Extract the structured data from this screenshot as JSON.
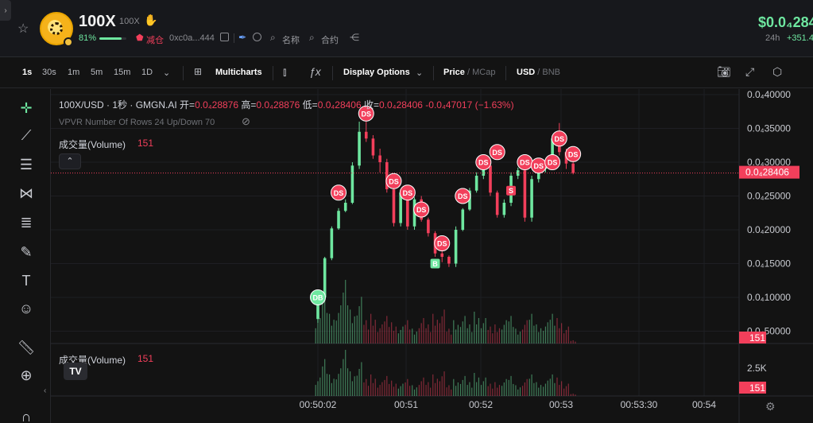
{
  "header": {
    "token_name": "100X",
    "token_symbol": "100X",
    "holder_pct": "81%",
    "holder_pct_value": 0.81,
    "reduce_label": "减仓",
    "address": "0xc0a...444",
    "search_name_label": "名称",
    "search_contract_label": "合约",
    "price": "$0.0₄284",
    "change_period": "24h",
    "change_value": "+351.4"
  },
  "toolbar": {
    "intervals": [
      "1s",
      "30s",
      "1m",
      "5m",
      "15m",
      "1D"
    ],
    "active_interval": "1s",
    "multicharts": "Multicharts",
    "display_options": "Display Options",
    "price_label": "Price",
    "mcap_label": "MCap",
    "usd_label": "USD",
    "bnb_label": "BNB"
  },
  "legend": {
    "pair": "100X/USD · 1秒 · GMGN.AI",
    "open_label": "开=",
    "open": "0.0₄28876",
    "high_label": "高=",
    "high": "0.0₄28876",
    "low_label": "低=",
    "low": "0.0₄28406",
    "close_label": "收=",
    "close": "0.0₄28406",
    "change": "-0.0₄47017 (−1.63%)",
    "vpvr": "VPVR Number Of Rows 24 Up/Down 70",
    "volume_label": "成交量(Volume)",
    "volume_value": "151"
  },
  "colors": {
    "up": "#6ee7a0",
    "down": "#f23f5b",
    "bg": "#131313"
  },
  "chart_data": {
    "type": "candlestick",
    "y_axis_ticks": [
      "0.0₄40000",
      "0.0₄35000",
      "0.0₄30000",
      "0.0₄25000",
      "0.0₄20000",
      "0.0₄15000",
      "0.0₄10000",
      "0.0₄50000"
    ],
    "y_range": [
      5e-06,
      4e-05
    ],
    "current_price_label": "0.0₄28406",
    "current_price": 2.84e-05,
    "x_axis_ticks": [
      "00:50:02",
      "00:51",
      "00:52",
      "00:53",
      "00:53:30",
      "00:54"
    ],
    "volume_axis_ticks": [
      "2.5K"
    ],
    "volume_badge": "151",
    "candles": [
      {
        "t": 0,
        "o": 6.8e-06,
        "h": 1.02e-05,
        "l": 6.2e-06,
        "c": 1e-05
      },
      {
        "t": 1,
        "o": 1e-05,
        "h": 1.6e-05,
        "l": 9.8e-06,
        "c": 1.58e-05
      },
      {
        "t": 2,
        "o": 1.58e-05,
        "h": 2.05e-05,
        "l": 1.55e-05,
        "c": 2.02e-05
      },
      {
        "t": 3,
        "o": 2.02e-05,
        "h": 2.32e-05,
        "l": 2e-05,
        "c": 2.28e-05
      },
      {
        "t": 4,
        "o": 2.28e-05,
        "h": 2.45e-05,
        "l": 2.26e-05,
        "c": 2.4e-05
      },
      {
        "t": 5,
        "o": 2.4e-05,
        "h": 3e-05,
        "l": 2.38e-05,
        "c": 2.95e-05
      },
      {
        "t": 6,
        "o": 2.95e-05,
        "h": 3.6e-05,
        "l": 2.9e-05,
        "c": 3.45e-05
      },
      {
        "t": 7,
        "o": 3.45e-05,
        "h": 3.7e-05,
        "l": 3.3e-05,
        "c": 3.35e-05
      },
      {
        "t": 8,
        "o": 3.35e-05,
        "h": 3.4e-05,
        "l": 3.05e-05,
        "c": 3.1e-05
      },
      {
        "t": 9,
        "o": 3.1e-05,
        "h": 3.2e-05,
        "l": 2.85e-05,
        "c": 3e-05
      },
      {
        "t": 10,
        "o": 3e-05,
        "h": 3.05e-05,
        "l": 2.55e-05,
        "c": 2.6e-05
      },
      {
        "t": 11,
        "o": 2.6e-05,
        "h": 2.62e-05,
        "l": 2.05e-05,
        "c": 2.1e-05
      },
      {
        "t": 12,
        "o": 2.1e-05,
        "h": 2.6e-05,
        "l": 2.05e-05,
        "c": 2.55e-05
      },
      {
        "t": 13,
        "o": 2.55e-05,
        "h": 2.65e-05,
        "l": 2e-05,
        "c": 2.05e-05
      },
      {
        "t": 14,
        "o": 2.05e-05,
        "h": 2.48e-05,
        "l": 2e-05,
        "c": 2.45e-05
      },
      {
        "t": 15,
        "o": 2.45e-05,
        "h": 2.5e-05,
        "l": 2.12e-05,
        "c": 2.15e-05
      },
      {
        "t": 16,
        "o": 2.15e-05,
        "h": 2.18e-05,
        "l": 1.9e-05,
        "c": 1.95e-05
      },
      {
        "t": 17,
        "o": 1.95e-05,
        "h": 1.98e-05,
        "l": 1.6e-05,
        "c": 1.65e-05
      },
      {
        "t": 18,
        "o": 1.65e-05,
        "h": 1.7e-05,
        "l": 1.52e-05,
        "c": 1.6e-05
      },
      {
        "t": 19,
        "o": 1.6e-05,
        "h": 1.62e-05,
        "l": 1.45e-05,
        "c": 1.5e-05
      },
      {
        "t": 20,
        "o": 1.5e-05,
        "h": 2.05e-05,
        "l": 1.45e-05,
        "c": 2e-05
      },
      {
        "t": 21,
        "o": 2e-05,
        "h": 2.32e-05,
        "l": 1.98e-05,
        "c": 2.3e-05
      },
      {
        "t": 22,
        "o": 2.3e-05,
        "h": 2.62e-05,
        "l": 2.28e-05,
        "c": 2.58e-05
      },
      {
        "t": 23,
        "o": 2.58e-05,
        "h": 2.85e-05,
        "l": 2.55e-05,
        "c": 2.8e-05
      },
      {
        "t": 24,
        "o": 2.8e-05,
        "h": 3e-05,
        "l": 2.75e-05,
        "c": 2.95e-05
      },
      {
        "t": 25,
        "o": 2.95e-05,
        "h": 2.98e-05,
        "l": 2.5e-05,
        "c": 2.55e-05
      },
      {
        "t": 26,
        "o": 2.55e-05,
        "h": 2.58e-05,
        "l": 2.18e-05,
        "c": 2.22e-05
      },
      {
        "t": 27,
        "o": 2.22e-05,
        "h": 2.45e-05,
        "l": 2.18e-05,
        "c": 2.4e-05
      },
      {
        "t": 28,
        "o": 2.4e-05,
        "h": 2.85e-05,
        "l": 2.35e-05,
        "c": 2.8e-05
      },
      {
        "t": 29,
        "o": 2.8e-05,
        "h": 2.92e-05,
        "l": 2.75e-05,
        "c": 2.88e-05
      },
      {
        "t": 30,
        "o": 2.88e-05,
        "h": 2.92e-05,
        "l": 2.12e-05,
        "c": 2.18e-05
      },
      {
        "t": 31,
        "o": 2.18e-05,
        "h": 2.8e-05,
        "l": 2.12e-05,
        "c": 2.75e-05
      },
      {
        "t": 32,
        "o": 2.75e-05,
        "h": 2.95e-05,
        "l": 2.7e-05,
        "c": 2.9e-05
      },
      {
        "t": 33,
        "o": 2.9e-05,
        "h": 3.05e-05,
        "l": 2.85e-05,
        "c": 3e-05
      },
      {
        "t": 34,
        "o": 3e-05,
        "h": 3.4e-05,
        "l": 2.95e-05,
        "c": 3.35e-05
      },
      {
        "t": 35,
        "o": 3.35e-05,
        "h": 3.58e-05,
        "l": 3.1e-05,
        "c": 3.15e-05
      },
      {
        "t": 36,
        "o": 3.15e-05,
        "h": 3.2e-05,
        "l": 2.9e-05,
        "c": 2.98e-05
      },
      {
        "t": 37,
        "o": 2.98e-05,
        "h": 3.1e-05,
        "l": 2.82e-05,
        "c": 2.84e-05
      }
    ],
    "volumes": [
      1200,
      2400,
      1400,
      1800,
      3000,
      1600,
      2200,
      1100,
      1400,
      900,
      1300,
      1000,
      800,
      1100,
      700,
      1200,
      900,
      1400,
      1600,
      700,
      1100,
      1300,
      900,
      1500,
      1200,
      800,
      900,
      1100,
      1300,
      700,
      1100,
      1400,
      900,
      1000,
      1400,
      1200,
      800,
      151
    ],
    "markers": [
      {
        "t": 0,
        "label": "DB",
        "side": "buy",
        "price": 1e-05
      },
      {
        "t": 3,
        "label": "DS",
        "side": "sell",
        "price": 2.55e-05
      },
      {
        "t": 7,
        "label": "DS",
        "side": "sell",
        "price": 3.72e-05
      },
      {
        "t": 11,
        "label": "DS",
        "side": "sell",
        "price": 2.72e-05
      },
      {
        "t": 13,
        "label": "DS",
        "side": "sell",
        "price": 2.55e-05
      },
      {
        "t": 15,
        "label": "DS",
        "side": "sell",
        "price": 2.3e-05
      },
      {
        "t": 17,
        "label": "B",
        "side": "buy",
        "price": 1.5e-05
      },
      {
        "t": 18,
        "label": "DS",
        "side": "sell",
        "price": 1.8e-05
      },
      {
        "t": 21,
        "label": "DS",
        "side": "sell",
        "price": 2.5e-05
      },
      {
        "t": 24,
        "label": "DS",
        "side": "sell",
        "price": 3e-05
      },
      {
        "t": 26,
        "label": "DS",
        "side": "sell",
        "price": 3.15e-05
      },
      {
        "t": 28,
        "label": "S",
        "side": "sell",
        "price": 2.58e-05
      },
      {
        "t": 30,
        "label": "DS",
        "side": "sell",
        "price": 3e-05
      },
      {
        "t": 32,
        "label": "DS",
        "side": "sell",
        "price": 2.95e-05
      },
      {
        "t": 34,
        "label": "DS",
        "side": "sell",
        "price": 3e-05
      },
      {
        "t": 35,
        "label": "DS",
        "side": "sell",
        "price": 3.35e-05
      },
      {
        "t": 37,
        "label": "DS",
        "side": "sell",
        "price": 3.12e-05
      }
    ]
  }
}
